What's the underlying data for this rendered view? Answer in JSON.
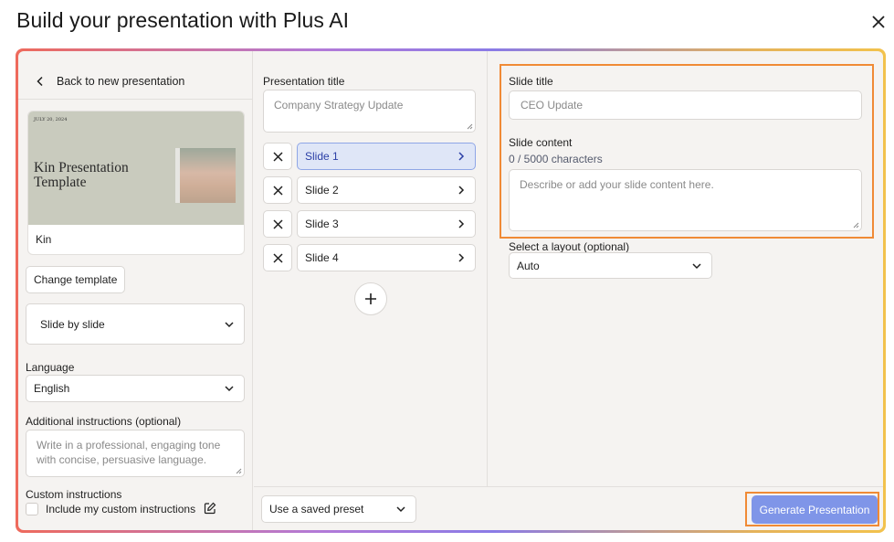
{
  "header": {
    "title": "Build your presentation with Plus AI"
  },
  "left": {
    "back_label": "Back to new presentation",
    "template": {
      "date": "JULY 20, 2024",
      "title_line1": "Kin Presentation",
      "title_line2": "Template",
      "name": "Kin"
    },
    "change_template_label": "Change template",
    "mode_select": "Slide by slide",
    "language_label": "Language",
    "language_value": "English",
    "additional_label": "Additional instructions (optional)",
    "additional_placeholder": "Write in a professional, engaging tone with concise, persuasive language.",
    "custom_label": "Custom instructions",
    "custom_checkbox_label": "Include my custom instructions"
  },
  "middle": {
    "pres_title_label": "Presentation title",
    "pres_title_placeholder": "Company Strategy Update",
    "slides": [
      {
        "label": "Slide 1",
        "active": true
      },
      {
        "label": "Slide 2",
        "active": false
      },
      {
        "label": "Slide 3",
        "active": false
      },
      {
        "label": "Slide 4",
        "active": false
      }
    ]
  },
  "right": {
    "slide_title_label": "Slide title",
    "slide_title_placeholder": "CEO Update",
    "slide_content_label": "Slide content",
    "char_count": "0 / 5000 characters",
    "slide_content_placeholder": "Describe or add your slide content here.",
    "layout_label": "Select a layout (optional)",
    "layout_value": "Auto"
  },
  "footer": {
    "preset_label": "Use a saved preset",
    "generate_label": "Generate Presentation"
  },
  "colors": {
    "accent": "#7f95e8",
    "highlight": "#f08a35",
    "active_slide_bg": "#dfe6f7"
  }
}
